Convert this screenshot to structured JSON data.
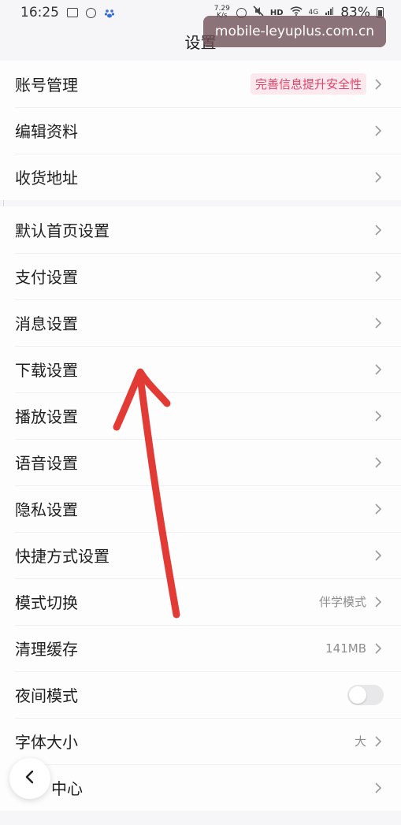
{
  "status_bar": {
    "time": "16:25",
    "net_speed_value": "7.29",
    "net_speed_unit": "K/s",
    "hd": "HD",
    "signal": "4G",
    "battery": "83%"
  },
  "watermark": "mobile-leyuplus.com.cn",
  "page": {
    "title": "设置"
  },
  "groups": [
    {
      "items": [
        {
          "label": "账号管理",
          "badge": "完善信息提升安全性"
        },
        {
          "label": "编辑资料"
        },
        {
          "label": "收货地址"
        }
      ]
    },
    {
      "items": [
        {
          "label": "默认首页设置"
        },
        {
          "label": "支付设置"
        },
        {
          "label": "消息设置"
        },
        {
          "label": "下载设置"
        },
        {
          "label": "播放设置"
        },
        {
          "label": "语音设置"
        },
        {
          "label": "隐私设置"
        },
        {
          "label": "快捷方式设置"
        },
        {
          "label": "模式切换",
          "value": "伴学模式"
        },
        {
          "label": "清理缓存",
          "value": "141MB"
        },
        {
          "label": "夜间模式",
          "toggle_on": false
        },
        {
          "label": "字体大小",
          "value": "大"
        },
        {
          "label": "中心"
        }
      ]
    }
  ],
  "colors": {
    "badge_text": "#e0446a",
    "badge_bg": "#fbe9ee",
    "annotation_arrow": "#e23b36",
    "watermark_bg": "#6e4e54"
  },
  "icons": {
    "chevron": "chevron-right-icon",
    "back": "chevron-left-icon"
  }
}
